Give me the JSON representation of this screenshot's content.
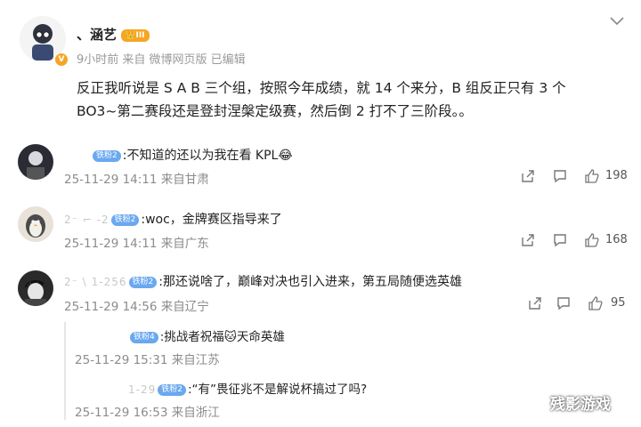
{
  "post": {
    "author": "、涵艺",
    "author_badge": "III",
    "meta": "9小时前  来自  微博网页版  已编辑",
    "body_line1": "反正我听说是 S A B 三个组，按照今年成绩，就 14 个来分，B 组反正只有 3 个",
    "body_line2": "BO3~第二赛段还是登封涅槃定级赛，然后倒 2 打不了三阶段。。"
  },
  "comments": [
    {
      "name_blur": "",
      "badge": "铁粉2",
      "text": ":不知道的还以为我在看 KPL😂",
      "date": "25-11-29  14:11  来自甘肃",
      "likes": "198"
    },
    {
      "name_blur": "2⁻  ⌐ -2",
      "badge": "铁粉2",
      "text": ":woc，金牌赛区指导来了",
      "date": "25-11-29  14:11  来自广东",
      "likes": "168"
    },
    {
      "name_blur": "2⁻ \\      1-256",
      "badge": "铁粉2",
      "text": ":那还说啥了，巅峰对决也引入进来，第五局随便选英雄",
      "date": "25-11-29  14:56  来自辽宁",
      "likes": "95"
    }
  ],
  "replies": [
    {
      "name_blur": "",
      "badge": "铁粉4",
      "text": ":挑战者祝福🐱天命英雄",
      "date": "25-11-29  15:31  来自江苏"
    },
    {
      "name_blur": "1-29",
      "badge": "铁粉2",
      "text": ":“有”畏征兆不是解说杯搞过了吗?",
      "date": "25-11-29  16:53  来自浙江"
    }
  ],
  "watermark": "残影游戏"
}
